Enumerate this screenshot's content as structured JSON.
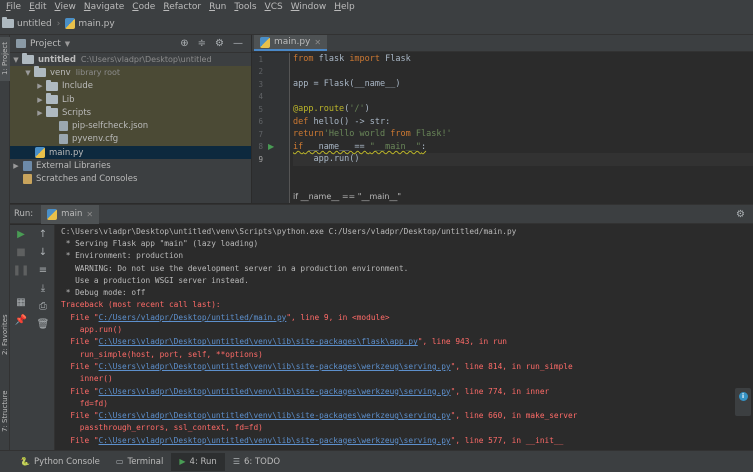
{
  "menu": [
    "File",
    "Edit",
    "View",
    "Navigate",
    "Code",
    "Refactor",
    "Run",
    "Tools",
    "VCS",
    "Window",
    "Help"
  ],
  "navbar": {
    "project": "untitled",
    "file": "main.py"
  },
  "left_strip": {
    "project_tab": "1: Project",
    "favorites_tab": "2: Favorites",
    "structure_tab": "7: Structure"
  },
  "project_panel": {
    "title": "Project",
    "tree": [
      {
        "label": "untitled",
        "hint": "C:\\Users\\vladpr\\Desktop\\untitled",
        "indent": 0,
        "type": "folder",
        "open": true
      },
      {
        "label": "venv",
        "hint": "library root",
        "indent": 1,
        "type": "folder",
        "open": true
      },
      {
        "label": "Include",
        "hint": "",
        "indent": 2,
        "type": "folder",
        "open": false,
        "leaf": true
      },
      {
        "label": "Lib",
        "hint": "",
        "indent": 2,
        "type": "folder",
        "open": false
      },
      {
        "label": "Scripts",
        "hint": "",
        "indent": 2,
        "type": "folder",
        "open": false
      },
      {
        "label": "pip-selfcheck.json",
        "hint": "",
        "indent": 3,
        "type": "file"
      },
      {
        "label": "pyvenv.cfg",
        "hint": "",
        "indent": 3,
        "type": "file"
      },
      {
        "label": "main.py",
        "hint": "",
        "indent": 1,
        "type": "py",
        "selected": true
      },
      {
        "label": "External Libraries",
        "hint": "",
        "indent": 0,
        "type": "lib",
        "open": false
      },
      {
        "label": "Scratches and Consoles",
        "hint": "",
        "indent": 0,
        "type": "scratch"
      }
    ]
  },
  "editor": {
    "tab_label": "main.py",
    "line_numbers": [
      "1",
      "2",
      "3",
      "4",
      "5",
      "6",
      "7",
      "8",
      "9"
    ],
    "code_lines": [
      "from flask import Flask",
      "",
      "app = Flask(__name__)",
      "",
      "@app.route('/')",
      "def hello() -> str:",
      "    return 'Hello world from Flask!'",
      "if __name__ == \"__main__\":",
      "    app.run()"
    ],
    "breadcrumb": "if __name__ == \"__main__\""
  },
  "run": {
    "title": "Run:",
    "tab_label": "main",
    "console": [
      {
        "t": "C:\\Users\\vladpr\\Desktop\\untitled\\venv\\Scripts\\python.exe C:/Users/vladpr/Desktop/untitled/main.py",
        "k": "norm"
      },
      {
        "t": " * Serving Flask app \"main\" (lazy loading)",
        "k": "norm"
      },
      {
        "t": " * Environment: production",
        "k": "norm"
      },
      {
        "t": "   WARNING: Do not use the development server in a production environment.",
        "k": "norm"
      },
      {
        "t": "   Use a production WSGI server instead.",
        "k": "norm"
      },
      {
        "t": " * Debug mode: off",
        "k": "norm"
      },
      {
        "t": "Traceback (most recent call last):",
        "k": "err"
      },
      {
        "pre": "  File \"",
        "link": "C:/Users/vladpr/Desktop/untitled/main.py",
        "post": "\", line 9, in <module>",
        "k": "err"
      },
      {
        "t": "    app.run()",
        "k": "err"
      },
      {
        "pre": "  File \"",
        "link": "C:\\Users\\vladpr\\Desktop\\untitled\\venv\\lib\\site-packages\\flask\\app.py",
        "post": "\", line 943, in run",
        "k": "err"
      },
      {
        "t": "    run_simple(host, port, self, **options)",
        "k": "err"
      },
      {
        "pre": "  File \"",
        "link": "C:\\Users\\vladpr\\Desktop\\untitled\\venv\\lib\\site-packages\\werkzeug\\serving.py",
        "post": "\", line 814, in run_simple",
        "k": "err"
      },
      {
        "t": "    inner()",
        "k": "err"
      },
      {
        "pre": "  File \"",
        "link": "C:\\Users\\vladpr\\Desktop\\untitled\\venv\\lib\\site-packages\\werkzeug\\serving.py",
        "post": "\", line 774, in inner",
        "k": "err"
      },
      {
        "t": "    fd=fd)",
        "k": "err"
      },
      {
        "pre": "  File \"",
        "link": "C:\\Users\\vladpr\\Desktop\\untitled\\venv\\lib\\site-packages\\werkzeug\\serving.py",
        "post": "\", line 660, in make_server",
        "k": "err"
      },
      {
        "t": "    passthrough_errors, ssl_context, fd=fd)",
        "k": "err"
      },
      {
        "pre": "  File \"",
        "link": "C:\\Users\\vladpr\\Desktop\\untitled\\venv\\lib\\site-packages\\werkzeug\\serving.py",
        "post": "\", line 577, in __init__",
        "k": "err"
      }
    ]
  },
  "bottom_bar": [
    {
      "label": "Python Console",
      "icon": "python-console-icon",
      "active": false
    },
    {
      "label": "Terminal",
      "icon": "terminal-icon",
      "active": false
    },
    {
      "label": "4: Run",
      "icon": "run-icon",
      "active": true
    },
    {
      "label": "6: TODO",
      "icon": "todo-icon",
      "active": false
    }
  ],
  "colors": {
    "accent": "#4a88c7",
    "error": "#ff6b68",
    "link": "#5d90cd",
    "keyword": "#cc7832",
    "string": "#6a8759",
    "decorator": "#bbb529",
    "run_green": "#499c54"
  }
}
